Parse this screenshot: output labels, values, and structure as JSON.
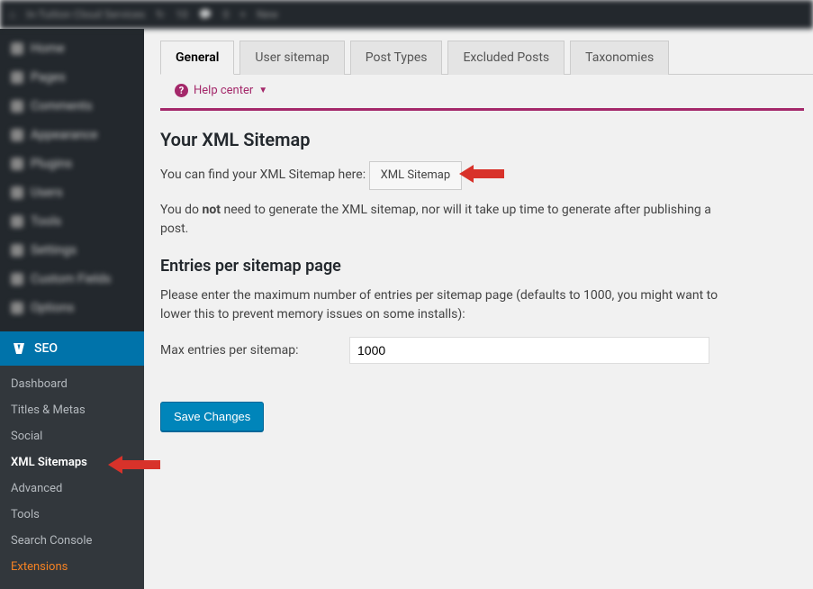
{
  "topbar": {
    "site_name": "In-Tuition Cloud Services",
    "updates": "10",
    "comments": "0",
    "new": "New"
  },
  "sidebar": {
    "blurred": [
      "Home",
      "Pages",
      "Comments",
      "Appearance",
      "Plugins",
      "Users",
      "Tools",
      "Settings",
      "Custom Fields",
      "Options"
    ],
    "seo_label": "SEO",
    "submenu": [
      {
        "label": "Dashboard",
        "active": false,
        "ext": false
      },
      {
        "label": "Titles & Metas",
        "active": false,
        "ext": false
      },
      {
        "label": "Social",
        "active": false,
        "ext": false
      },
      {
        "label": "XML Sitemaps",
        "active": true,
        "ext": false
      },
      {
        "label": "Advanced",
        "active": false,
        "ext": false
      },
      {
        "label": "Tools",
        "active": false,
        "ext": false
      },
      {
        "label": "Search Console",
        "active": false,
        "ext": false
      },
      {
        "label": "Extensions",
        "active": false,
        "ext": true
      }
    ]
  },
  "tabs": [
    {
      "label": "General",
      "active": true
    },
    {
      "label": "User sitemap",
      "active": false
    },
    {
      "label": "Post Types",
      "active": false
    },
    {
      "label": "Excluded Posts",
      "active": false
    },
    {
      "label": "Taxonomies",
      "active": false
    }
  ],
  "help_center": "Help center",
  "h2": "Your XML Sitemap",
  "p1_pre": "You can find your XML Sitemap here: ",
  "sitemap_btn": "XML Sitemap",
  "p2_a": "You do ",
  "p2_b": "not",
  "p2_c": " need to generate the XML sitemap, nor will it take up time to generate after publishing a post.",
  "h3": "Entries per sitemap page",
  "p3": "Please enter the maximum number of entries per sitemap page (defaults to 1000, you might want to lower this to prevent memory issues on some installs):",
  "max_label": "Max entries per sitemap:",
  "max_value": "1000",
  "save": "Save Changes"
}
